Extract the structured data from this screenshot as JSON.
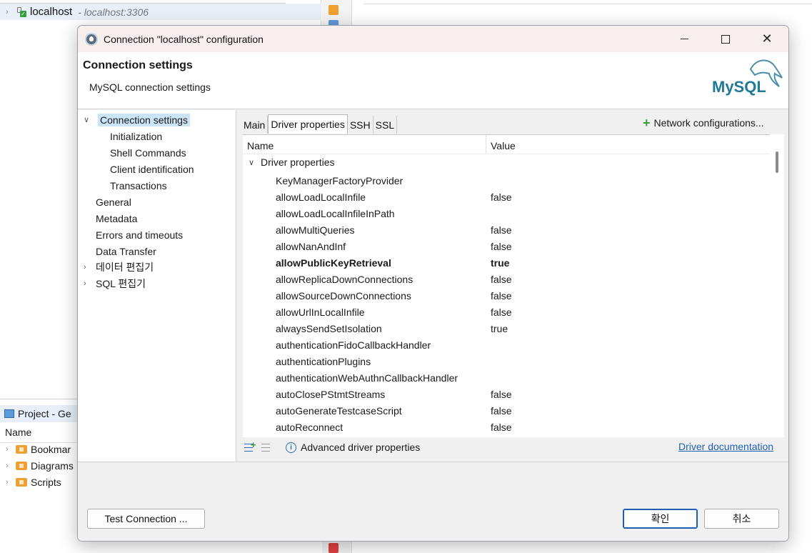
{
  "background": {
    "nav_host": "localhost",
    "nav_host_sub": "- localhost:3306",
    "project_tab": "Project - Ge",
    "project_col": "Name",
    "project_items": [
      "Bookmar",
      "Diagrams",
      "Scripts"
    ]
  },
  "dialog": {
    "title": "Connection \"localhost\" configuration",
    "header_title": "Connection settings",
    "header_sub": "MySQL connection settings",
    "logo_text": "MySQL"
  },
  "tree": [
    {
      "label": "Connection settings",
      "expanded": true
    },
    {
      "label": "Initialization"
    },
    {
      "label": "Shell Commands"
    },
    {
      "label": "Client identification"
    },
    {
      "label": "Transactions"
    },
    {
      "label": "General"
    },
    {
      "label": "Metadata"
    },
    {
      "label": "Errors and timeouts"
    },
    {
      "label": "Data Transfer"
    },
    {
      "label": "데이터 편집기",
      "collapsed": true
    },
    {
      "label": "SQL 편집기",
      "collapsed": true
    }
  ],
  "tabs": [
    "Main",
    "Driver properties",
    "SSH",
    "SSL"
  ],
  "network_config": "Network configurations...",
  "table": {
    "col_name": "Name",
    "col_value": "Value",
    "group": "Driver properties",
    "rows": [
      {
        "name": "KeyManagerFactoryProvider",
        "value": ""
      },
      {
        "name": "allowLoadLocalInfile",
        "value": "false"
      },
      {
        "name": "allowLoadLocalInfileInPath",
        "value": ""
      },
      {
        "name": "allowMultiQueries",
        "value": "false"
      },
      {
        "name": "allowNanAndInf",
        "value": "false"
      },
      {
        "name": "allowPublicKeyRetrieval",
        "value": "true"
      },
      {
        "name": "allowReplicaDownConnections",
        "value": "false"
      },
      {
        "name": "allowSourceDownConnections",
        "value": "false"
      },
      {
        "name": "allowUrlInLocalInfile",
        "value": "false"
      },
      {
        "name": "alwaysSendSetIsolation",
        "value": "true"
      },
      {
        "name": "authenticationFidoCallbackHandler",
        "value": ""
      },
      {
        "name": "authenticationPlugins",
        "value": ""
      },
      {
        "name": "authenticationWebAuthnCallbackHandler",
        "value": ""
      },
      {
        "name": "autoClosePStmtStreams",
        "value": "false"
      },
      {
        "name": "autoGenerateTestcaseScript",
        "value": "false"
      },
      {
        "name": "autoReconnect",
        "value": "false"
      }
    ]
  },
  "bottom": {
    "advanced": "Advanced driver properties",
    "doc_link": "Driver documentation"
  },
  "footer": {
    "test_connection": "Test Connection ...",
    "ok": "확인",
    "cancel": "취소"
  },
  "colors": {
    "accent": "#1f5fb3",
    "selection": "#cce4f7",
    "add_green": "#3a9c3a"
  }
}
